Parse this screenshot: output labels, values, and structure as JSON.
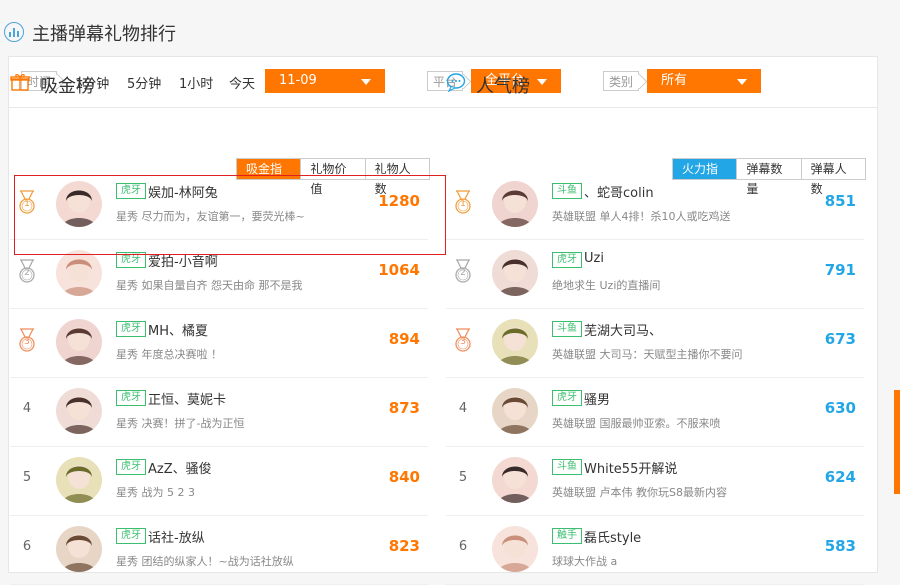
{
  "header": {
    "title": "主播弹幕礼物排行"
  },
  "filters": {
    "time_label": "时间",
    "time_options": [
      "1分钟",
      "5分钟",
      "1小时",
      "今天"
    ],
    "date_value": "11-09",
    "platform_label": "平台",
    "platform_value": "全平台",
    "category_label": "类别",
    "category_value": "所有"
  },
  "left": {
    "title": "吸金榜",
    "tabs": [
      "吸金指数",
      "礼物价值",
      "礼物人数"
    ],
    "rows": [
      {
        "rank": "1",
        "tag": "虎牙",
        "name": "娱加-林阿兔",
        "desc": "星秀 尽力而为，友谊第一，要荧光棒~",
        "score": "1280"
      },
      {
        "rank": "2",
        "tag": "虎牙",
        "name": "爱拍-小音啊",
        "desc": "星秀 如果自量自齐 怨天由命 那不是我",
        "score": "1064"
      },
      {
        "rank": "3",
        "tag": "虎牙",
        "name": "MH、橘夏",
        "desc": "星秀 年度总决赛啦 ！",
        "score": "894"
      },
      {
        "rank": "4",
        "tag": "虎牙",
        "name": "正恒、莫妮卡",
        "desc": "星秀 决赛！拼了-战为正恒",
        "score": "873"
      },
      {
        "rank": "5",
        "tag": "虎牙",
        "name": "AzZ、骚俊",
        "desc": "星秀 战为 5 2 3",
        "score": "840"
      },
      {
        "rank": "6",
        "tag": "虎牙",
        "name": "话社-放纵",
        "desc": "星秀 团结的纵家人！~战为话社放纵",
        "score": "823"
      }
    ]
  },
  "right": {
    "title": "人气榜",
    "tabs": [
      "火力指数",
      "弹幕数量",
      "弹幕人数"
    ],
    "rows": [
      {
        "rank": "1",
        "tag": "斗鱼",
        "name": "、蛇哥colin",
        "desc": "英雄联盟 单人4排！杀10人或吃鸡送",
        "score": "851"
      },
      {
        "rank": "2",
        "tag": "虎牙",
        "name": "Uzi",
        "desc": "绝地求生 Uzi的直播间",
        "score": "791"
      },
      {
        "rank": "3",
        "tag": "斗鱼",
        "name": "芜湖大司马、",
        "desc": "英雄联盟 大司马：天赋型主播你不要问",
        "score": "673"
      },
      {
        "rank": "4",
        "tag": "虎牙",
        "name": "骚男",
        "desc": "英雄联盟 国服最帅亚索。不服来喷",
        "score": "630"
      },
      {
        "rank": "5",
        "tag": "斗鱼",
        "name": "White55开解说",
        "desc": "英雄联盟 卢本伟 教你玩S8最新内容",
        "score": "624"
      },
      {
        "rank": "6",
        "tag": "触手",
        "name": "磊氏style",
        "desc": "球球大作战 a",
        "score": "583"
      }
    ]
  },
  "colors": {
    "accent_orange": "#ff7700",
    "accent_blue": "#23a6e6",
    "tag_green": "#3bbf6f",
    "highlight_red": "#e02020"
  }
}
